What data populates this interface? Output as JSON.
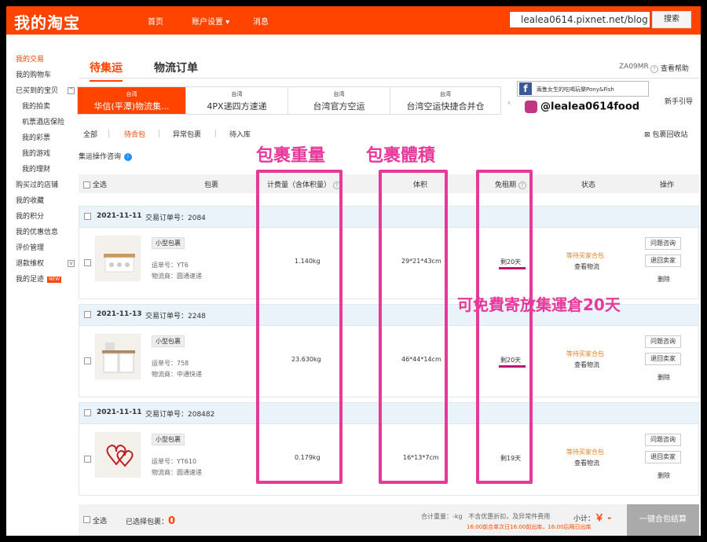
{
  "header": {
    "logo": "我的淘宝",
    "nav": [
      "首页",
      "账户设置 ▾",
      "消息"
    ],
    "search_value": "lealea0614.pixnet.net/blog",
    "search_btn": "搜索"
  },
  "sidebar": {
    "items": [
      {
        "label": "我的交易",
        "active": true
      },
      {
        "label": "我的购物车"
      },
      {
        "label": "已买到的宝贝"
      },
      {
        "label": "我的拍卖",
        "sub": true
      },
      {
        "label": "机票酒店保险",
        "sub": true
      },
      {
        "label": "我的彩票",
        "sub": true
      },
      {
        "label": "我的游戏",
        "sub": true
      },
      {
        "label": "我的理财",
        "sub": true
      },
      {
        "label": "购买过的店铺"
      },
      {
        "label": "我的收藏"
      },
      {
        "label": "我的积分"
      },
      {
        "label": "我的优惠信息"
      },
      {
        "label": "评价管理"
      },
      {
        "label": "退款维权"
      },
      {
        "label": "我的足迹"
      }
    ],
    "new_badge": "NEW"
  },
  "tabs": {
    "main": [
      "待集运",
      "物流订单"
    ],
    "user_suffix": "ZA09MR",
    "help": "查看帮助",
    "new_guide": "新手引导"
  },
  "shipping": [
    {
      "region": "台湾",
      "name": "华信(平潭)物流集..."
    },
    {
      "region": "台湾",
      "name": "4PX递四方速递"
    },
    {
      "region": "台湾",
      "name": "台湾官方空运"
    },
    {
      "region": "台湾",
      "name": "台湾空运快捷合并仓"
    }
  ],
  "subtabs": [
    "全部",
    "待合包",
    "异常包裹",
    "待入库"
  ],
  "recycle_bin": "包裹回收站",
  "consult": "集运操作咨询",
  "table_headers": {
    "select_all": "全选",
    "package": "包裹",
    "weight": "计费量（含体积量）",
    "volume": "体积",
    "free_period": "免租期",
    "status": "状态",
    "action": "操作"
  },
  "packages": [
    {
      "date": "2021-11-11",
      "order": "交易订单号：2084",
      "tag": "小型包裹",
      "tracking": "运单号：YT6",
      "carrier": "物流商：圆通速递",
      "weight": "1.140kg",
      "volume": "29*21*43cm",
      "period": "剩20天",
      "status": "等待买家合包",
      "view": "查看物流",
      "btn1": "问题咨询",
      "btn2": "退回卖家",
      "del": "删除"
    },
    {
      "date": "2021-11-13",
      "order": "交易订单号：2248",
      "tag": "小型包裹",
      "tracking": "运单号：758",
      "carrier": "物流商：中通快递",
      "weight": "23.630kg",
      "volume": "46*44*14cm",
      "period": "剩20天",
      "status": "等待买家合包",
      "view": "查看物流",
      "btn1": "问题咨询",
      "btn2": "退回卖家",
      "del": "删除"
    },
    {
      "date": "2021-11-11",
      "order": "交易订单号：208482",
      "tag": "小型包裹",
      "tracking": "运单号：YT610",
      "carrier": "物流商：圆通速递",
      "weight": "0.179kg",
      "volume": "16*13*7cm",
      "period": "剩19天",
      "status": "等待买家合包",
      "view": "查看物流",
      "btn1": "问题咨询",
      "btn2": "退回卖家",
      "del": "删除"
    }
  ],
  "footer": {
    "select_all": "全选",
    "selected_label": "已选择包裹：",
    "selected_count": "0",
    "total_weight": "合计重量：-kg",
    "note1": "不含优惠折扣，及异常件费用",
    "note2": "16:00前合单次日16:00前出库，16:00后隔日出库",
    "subtotal_label": "小计：",
    "subtotal_value": "￥ -",
    "checkout": "一键合包结算"
  },
  "annotations": {
    "weight": "包裹重量",
    "volume": "包裹體積",
    "free": "可免費寄放集運倉20天"
  },
  "watermark": {
    "fb_text": "兩隻女生的吃喝玩樂Pony&Fish",
    "ig_text": "@lealea0614food"
  },
  "colors": {
    "brand": "#ff4400",
    "annotation": "#e8389a"
  }
}
